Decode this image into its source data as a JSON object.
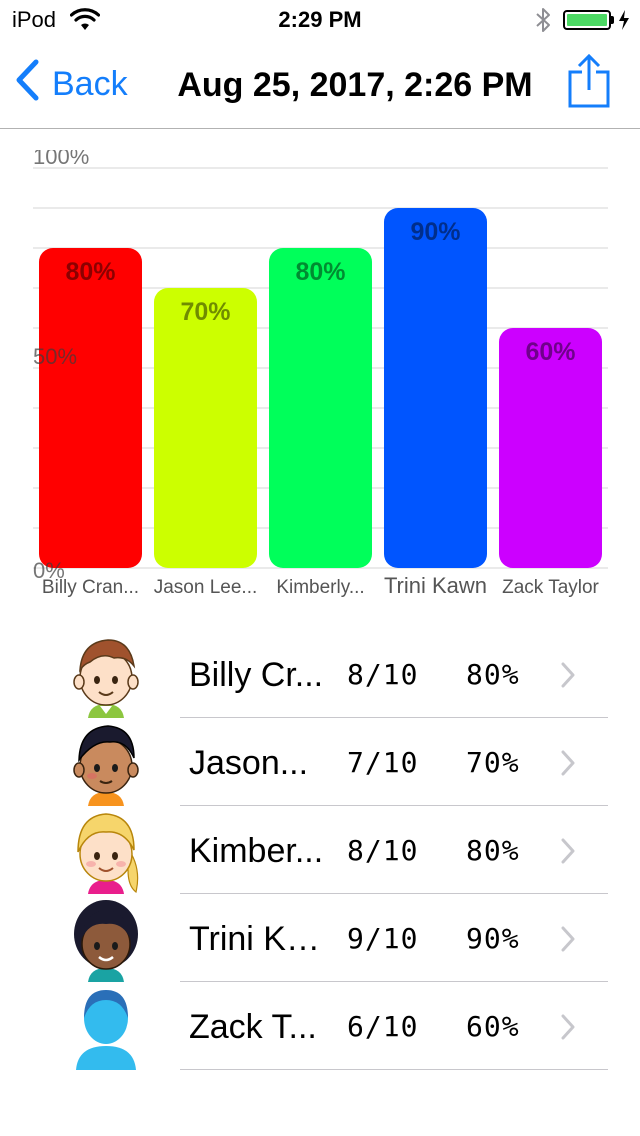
{
  "status_bar": {
    "carrier": "iPod",
    "time": "2:29 PM",
    "battery_percent": 100
  },
  "nav": {
    "back_label": "Back",
    "title": "Aug 25, 2017, 2:26 PM",
    "icons": {
      "back": "chevron-left-icon",
      "share": "share-icon"
    }
  },
  "chart_data": {
    "type": "bar",
    "categories": [
      "Billy Cran...",
      "Jason Lee...",
      "Kimberly...",
      "Trini Kawn",
      "Zack Taylor"
    ],
    "values": [
      80,
      70,
      80,
      90,
      60
    ],
    "value_labels": [
      "80%",
      "70%",
      "80%",
      "90%",
      "60%"
    ],
    "colors": [
      "#ff0000",
      "#ccff00",
      "#00ff5a",
      "#0055ff",
      "#cc00ff"
    ],
    "y_tick_labels": [
      "100%",
      "50%",
      "0%"
    ],
    "ylim": [
      0,
      100
    ],
    "grid": true,
    "title": "",
    "xlabel": "",
    "ylabel": ""
  },
  "students": [
    {
      "name": "Billy Cr...",
      "score": "8/10",
      "percent": "80%",
      "avatar": "boy-brown-hair-avatar"
    },
    {
      "name": "Jason...",
      "score": "7/10",
      "percent": "70%",
      "avatar": "boy-black-hair-avatar"
    },
    {
      "name": "Kimber...",
      "score": "8/10",
      "percent": "80%",
      "avatar": "girl-blonde-hair-avatar"
    },
    {
      "name": "Trini Ka...",
      "score": "9/10",
      "percent": "90%",
      "avatar": "girl-dark-hair-avatar"
    },
    {
      "name": "Zack T...",
      "score": "6/10",
      "percent": "60%",
      "avatar": "default-person-avatar"
    }
  ],
  "accent_color": "#147efb"
}
